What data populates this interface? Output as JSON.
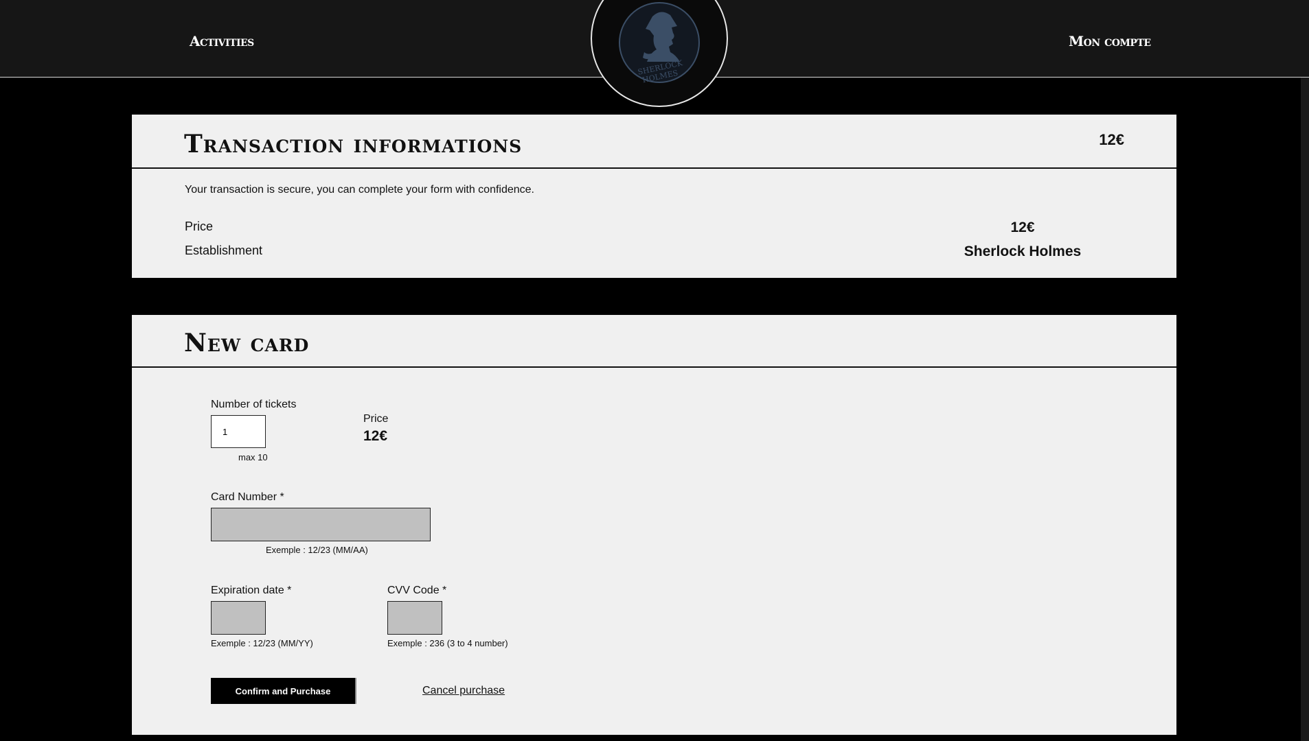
{
  "header": {
    "nav_activities": "Activities",
    "nav_account": "Mon compte",
    "logo_line1": "SHERLOCK",
    "logo_line2": "HOLMES"
  },
  "transaction": {
    "title": "Transaction informations",
    "top_price": "12€",
    "secure_message": "Your transaction is secure, you can complete your form with confidence.",
    "price_label": "Price",
    "price_value": "12€",
    "establishment_label": "Establishment",
    "establishment_value": "Sherlock Holmes"
  },
  "new_card": {
    "title": "New card",
    "tickets_label": "Number of tickets",
    "tickets_value": "1",
    "tickets_help": "max 10",
    "price_label": "Price",
    "price_value": "12€",
    "card_number_label": "Card Number *",
    "card_number_help": "Exemple : 12/23 (MM/AA)",
    "card_number_value": "",
    "expiration_label": "Expiration date *",
    "expiration_help": "Exemple : 12/23 (MM/YY)",
    "expiration_value": "",
    "cvv_label": "CVV Code *",
    "cvv_help": "Exemple : 236 (3 to 4 number)",
    "cvv_value": "",
    "confirm_button": "Confirm and Purchase",
    "cancel_link": "Cancel purchase"
  },
  "colors": {
    "page_background": "#000000",
    "header_background": "#161616",
    "card_background": "#f0f0f0",
    "logo_silhouette": "#3b4e66",
    "input_disabled": "#c0c0c0"
  }
}
